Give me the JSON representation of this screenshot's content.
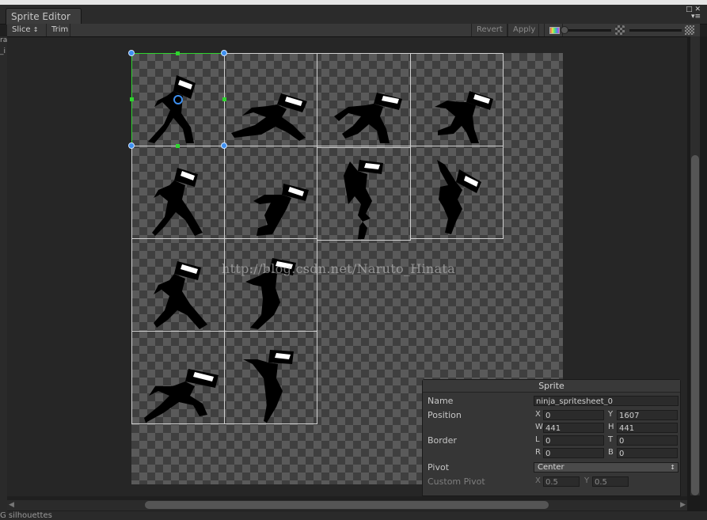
{
  "window": {
    "tab_title": "Sprite Editor"
  },
  "toolbar": {
    "slice_label": "Slice",
    "slice_arrow": "↕",
    "trim_label": "Trim",
    "revert_label": "Revert",
    "apply_label": "Apply"
  },
  "canvas": {
    "watermark": "http://blog.csdn.net/Naruto_Hinata"
  },
  "sprite_panel": {
    "title": "Sprite",
    "name_label": "Name",
    "name_value": "ninja_spritesheet_0",
    "position_label": "Position",
    "x_label": "X",
    "x_value": "0",
    "y_label": "Y",
    "y_value": "1607",
    "w_label": "W",
    "w_value": "441",
    "h_label": "H",
    "h_value": "441",
    "border_label": "Border",
    "l_label": "L",
    "l_value": "0",
    "t_label": "T",
    "t_value": "0",
    "r_label": "R",
    "r_value": "0",
    "b_label": "B",
    "b_value": "0",
    "pivot_label": "Pivot",
    "pivot_value": "Center",
    "custom_pivot_label": "Custom Pivot",
    "cp_x_label": "X",
    "cp_x_value": "0.5",
    "cp_y_label": "Y",
    "cp_y_value": "0.5"
  },
  "background": {
    "bottom_text": "G  silhouettes"
  },
  "colors": {
    "selection": "#2fd52f",
    "handle": "#3d8ff0",
    "cell_outline": "#d0d0d0"
  }
}
